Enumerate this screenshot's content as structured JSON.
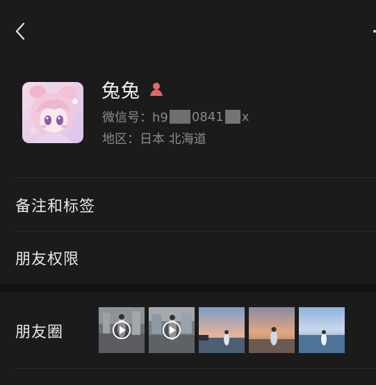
{
  "profile": {
    "name": "兔兔",
    "wechat_id_prefix": "微信号：h9",
    "wechat_id_mid": "0841",
    "wechat_id_suffix": "x",
    "region": "地区：日本 北海道"
  },
  "menu": {
    "remarks_tags": "备注和标签",
    "friend_permissions": "朋友权限",
    "moments": "朋友圈"
  },
  "icons": {
    "back": "chevron-left-icon",
    "more": "more-vertical-icon",
    "gender": "female-icon",
    "play": "play-icon"
  },
  "colors": {
    "background": "#1b1b1b",
    "text_primary": "#e8e8e8",
    "text_secondary": "#8a8a8a",
    "gender": "#e06a6a"
  }
}
